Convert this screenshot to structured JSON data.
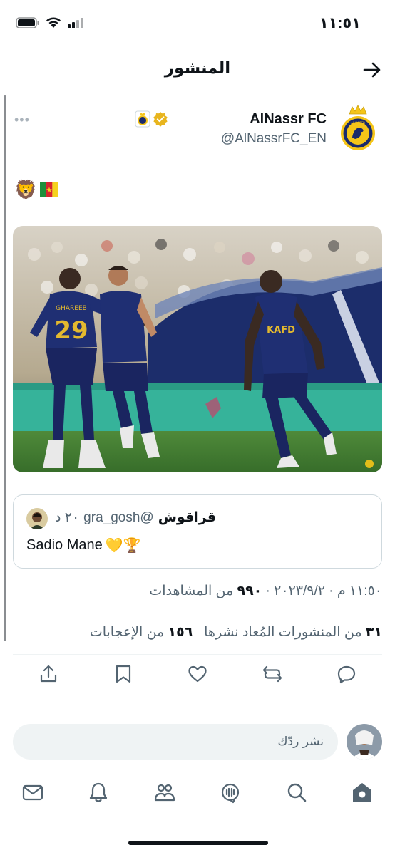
{
  "status_bar": {
    "time": "١١:٥١"
  },
  "top_bar": {
    "title": "المنشور"
  },
  "tweet": {
    "author_name": "AlNassr FC",
    "author_handle": "@AlNassrFC_EN",
    "more_label": "•••",
    "emoji_text": "🦁",
    "flag_name": "cameroon-flag",
    "photo_jersey_number": "29",
    "photo_jersey_name": "GHAREEB",
    "photo_sponsor": "KAFD"
  },
  "quote": {
    "name": "قراقوش",
    "handle": "@gra_gosh",
    "time": "٢٠ د",
    "text": "Sadio Mane",
    "text_emoji": "💛🏆"
  },
  "meta": {
    "time": "١١:٥٠ م",
    "date": "٢٠٢٣/٩/٢",
    "views_count": "٩٩٠",
    "views_label": "من المشاهدات"
  },
  "stats": {
    "reposts_count": "٣١",
    "reposts_label": "من المنشورات المُعاد نشرها",
    "likes_count": "١٥٦",
    "likes_label": "من الإعجابات"
  },
  "reply": {
    "placeholder": "نشر ردّك"
  },
  "colors": {
    "text": "#0f1419",
    "secondary": "#536471",
    "gold": "#f5c518",
    "navy": "#1a2a6c"
  },
  "nav": {
    "items": [
      "home-icon",
      "search-icon",
      "spaces-icon",
      "communities-icon",
      "notifications-icon",
      "messages-icon"
    ]
  }
}
